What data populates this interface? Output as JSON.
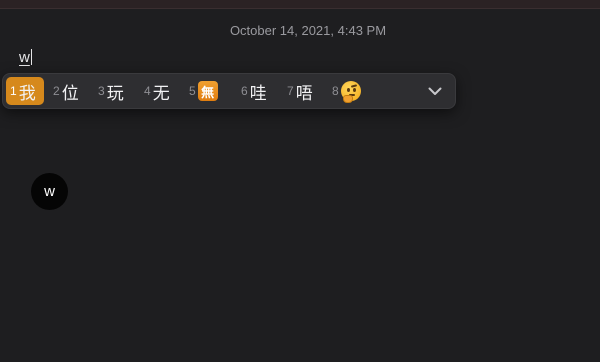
{
  "conversation": {
    "timestamp": "October 14, 2021, 4:43 PM",
    "avatar_initial": "w"
  },
  "composer": {
    "typed_text": "w"
  },
  "ime": {
    "candidates": [
      {
        "number": "1",
        "text": "我",
        "selected": true
      },
      {
        "number": "2",
        "text": "位",
        "selected": false
      },
      {
        "number": "3",
        "text": "玩",
        "selected": false
      },
      {
        "number": "4",
        "text": "无",
        "selected": false
      },
      {
        "number": "5",
        "text": "無",
        "kind": "emoji-box",
        "selected": false
      },
      {
        "number": "6",
        "text": "哇",
        "selected": false
      },
      {
        "number": "7",
        "text": "唔",
        "selected": false
      },
      {
        "number": "8",
        "text": "thinking-face-emoji",
        "kind": "emoji",
        "selected": false
      }
    ],
    "accent_color": "#d6891c",
    "expand_icon": "chevron-down-icon"
  }
}
